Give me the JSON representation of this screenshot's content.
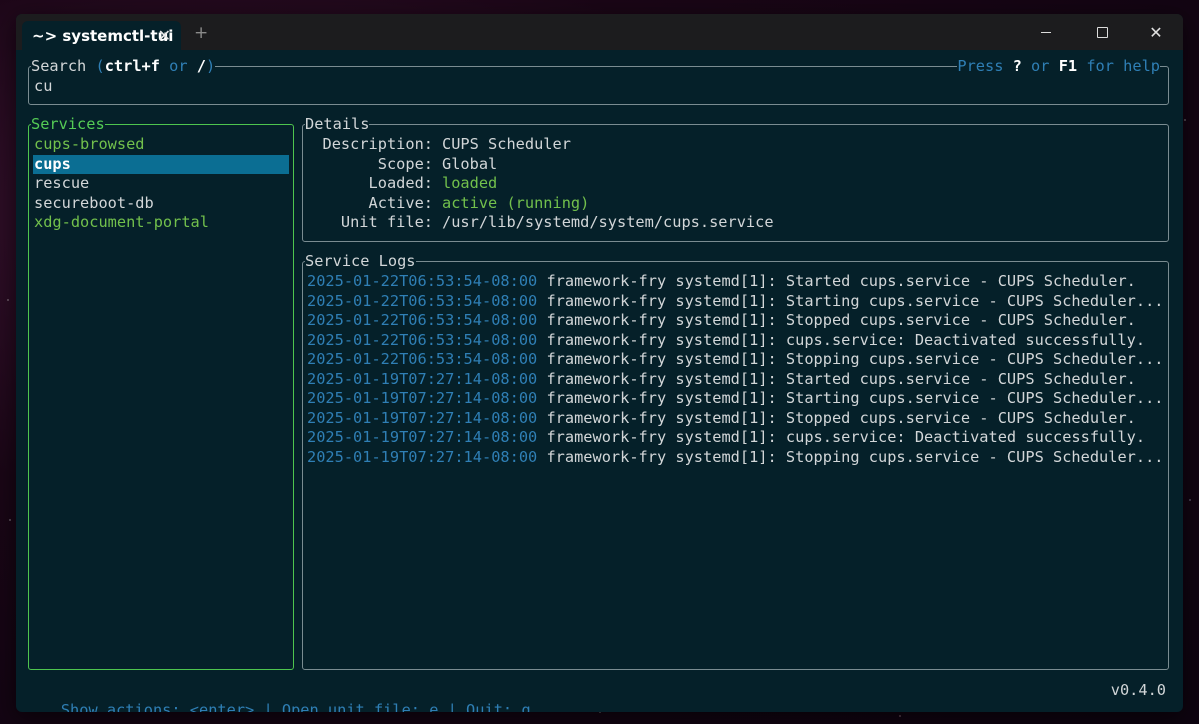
{
  "window": {
    "tab_title": "~> systemctl-tui",
    "tab_close": "✕",
    "new_tab": "+",
    "close_glyph": "✕"
  },
  "search": {
    "title_prefix": "Search",
    "title_open": " (",
    "shortcut1": "ctrl+f",
    "or_word": " or ",
    "shortcut2": "/",
    "title_close": ")",
    "help_press": "Press ",
    "help_key1": "?",
    "help_or": " or ",
    "help_key2": "F1",
    "help_suffix": " for help",
    "value": "cu"
  },
  "services": {
    "title": "Services",
    "items": [
      {
        "label": "cups-browsed"
      },
      {
        "label": "cups"
      },
      {
        "label": "rescue"
      },
      {
        "label": "secureboot-db"
      },
      {
        "label": "xdg-document-portal"
      }
    ]
  },
  "details": {
    "title": "Details",
    "rows": [
      {
        "key": "Description:",
        "value": "CUPS Scheduler"
      },
      {
        "key": "Scope:",
        "value": "Global"
      },
      {
        "key": "Loaded:",
        "value": "loaded"
      },
      {
        "key": "Active:",
        "value": "active (running)"
      },
      {
        "key": "Unit file:",
        "value": "/usr/lib/systemd/system/cups.service"
      }
    ]
  },
  "logs": {
    "title": "Service Logs",
    "entries": [
      {
        "ts": "2025-01-22T06:53:54-08:00",
        "msg": " framework-fry systemd[1]: Started cups.service - CUPS Scheduler."
      },
      {
        "ts": "2025-01-22T06:53:54-08:00",
        "msg": " framework-fry systemd[1]: Starting cups.service - CUPS Scheduler..."
      },
      {
        "ts": "2025-01-22T06:53:54-08:00",
        "msg": " framework-fry systemd[1]: Stopped cups.service - CUPS Scheduler."
      },
      {
        "ts": "2025-01-22T06:53:54-08:00",
        "msg": " framework-fry systemd[1]: cups.service: Deactivated successfully."
      },
      {
        "ts": "2025-01-22T06:53:54-08:00",
        "msg": " framework-fry systemd[1]: Stopping cups.service - CUPS Scheduler..."
      },
      {
        "ts": "2025-01-19T07:27:14-08:00",
        "msg": " framework-fry systemd[1]: Started cups.service - CUPS Scheduler."
      },
      {
        "ts": "2025-01-19T07:27:14-08:00",
        "msg": " framework-fry systemd[1]: Starting cups.service - CUPS Scheduler..."
      },
      {
        "ts": "2025-01-19T07:27:14-08:00",
        "msg": " framework-fry systemd[1]: Stopped cups.service - CUPS Scheduler."
      },
      {
        "ts": "2025-01-19T07:27:14-08:00",
        "msg": " framework-fry systemd[1]: cups.service: Deactivated successfully."
      },
      {
        "ts": "2025-01-19T07:27:14-08:00",
        "msg": " framework-fry systemd[1]: Stopping cups.service - CUPS Scheduler..."
      }
    ]
  },
  "footer": {
    "hints": "Show actions: <enter> | Open unit file: e | Quit: q",
    "version": "v0.4.0"
  },
  "colors": {
    "terminal_bg": "#052029",
    "accent_green": "#72c04c",
    "accent_blue": "#2f7fb5",
    "selection_bg": "#0b6e93"
  }
}
